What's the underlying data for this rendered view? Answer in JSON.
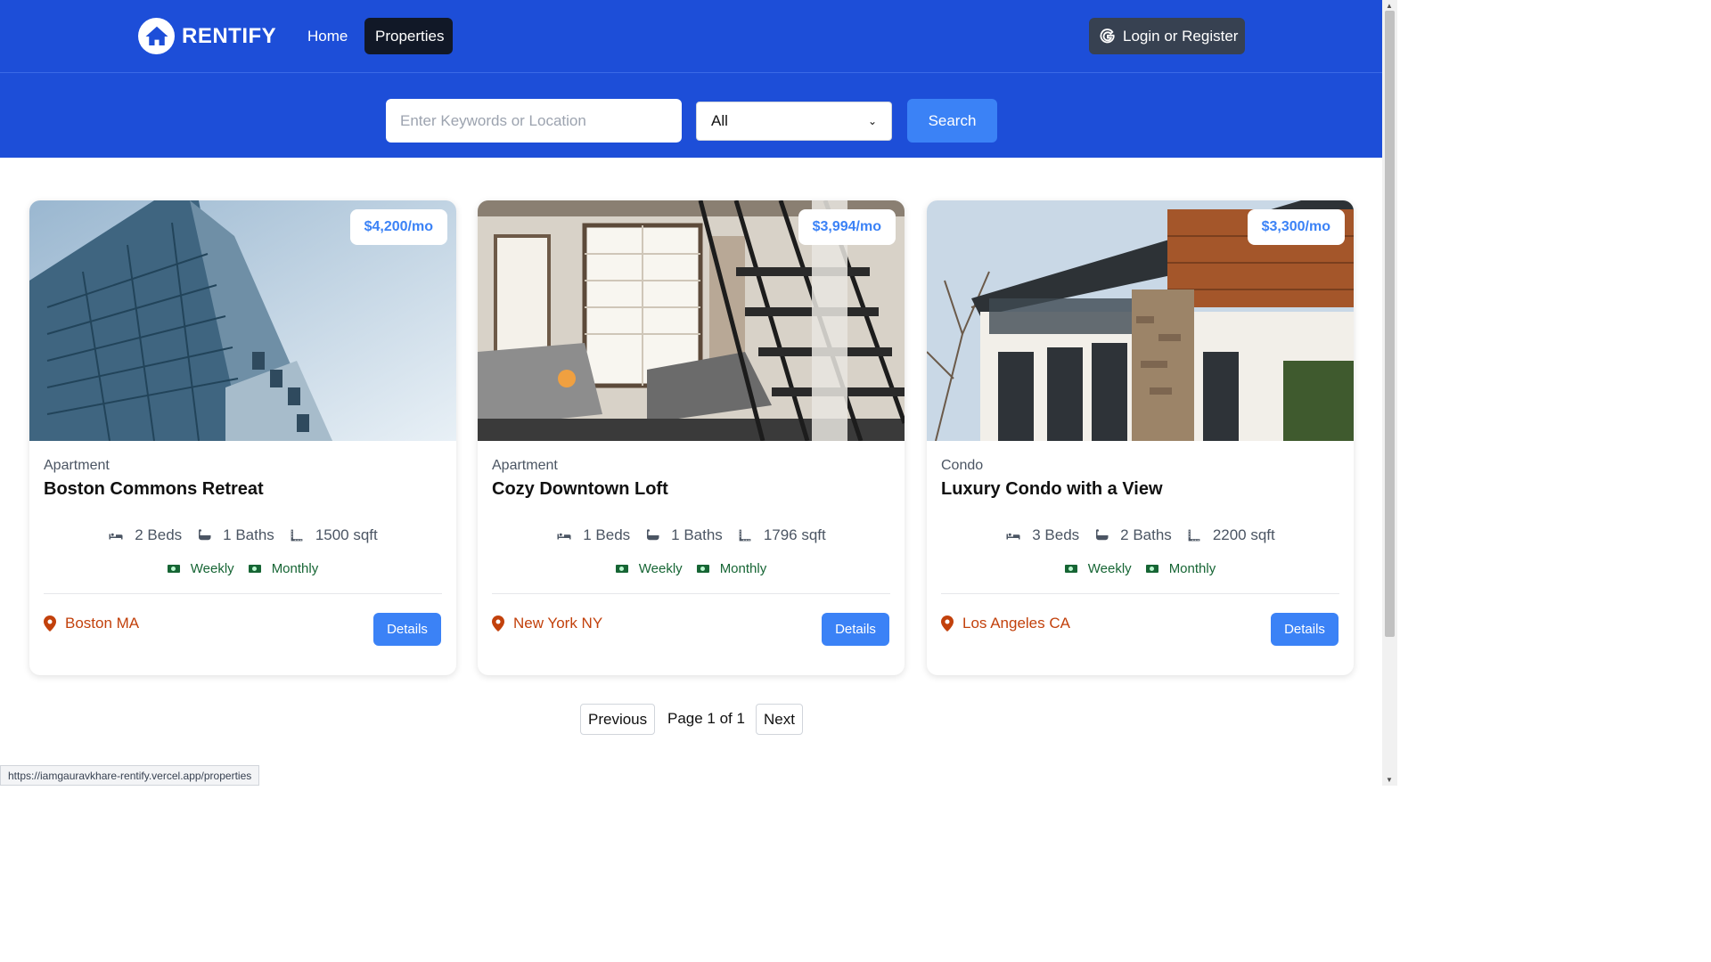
{
  "nav": {
    "brand": "RENTIFY",
    "home": "Home",
    "properties": "Properties",
    "login": "Login or Register"
  },
  "search": {
    "placeholder": "Enter Keywords or Location",
    "type_selected": "All",
    "button": "Search"
  },
  "properties": [
    {
      "type": "Apartment",
      "name": "Boston Commons Retreat",
      "price": "$4,200/mo",
      "beds": "2 Beds",
      "baths": "1 Baths",
      "sqft": "1500 sqft",
      "rate_weekly": "Weekly",
      "rate_monthly": "Monthly",
      "location": "Boston MA",
      "details": "Details"
    },
    {
      "type": "Apartment",
      "name": "Cozy Downtown Loft",
      "price": "$3,994/mo",
      "beds": "1 Beds",
      "baths": "1 Baths",
      "sqft": "1796 sqft",
      "rate_weekly": "Weekly",
      "rate_monthly": "Monthly",
      "location": "New York NY",
      "details": "Details"
    },
    {
      "type": "Condo",
      "name": "Luxury Condo with a View",
      "price": "$3,300/mo",
      "beds": "3 Beds",
      "baths": "2 Baths",
      "sqft": "2200 sqft",
      "rate_weekly": "Weekly",
      "rate_monthly": "Monthly",
      "location": "Los Angeles CA",
      "details": "Details"
    }
  ],
  "pagination": {
    "previous": "Previous",
    "page_info": "Page 1 of 1",
    "next": "Next"
  },
  "status_url": "https://iamgauravkhare-rentify.vercel.app/properties",
  "colors": {
    "primary": "#1d4ed8",
    "accent": "#3b82f6",
    "location": "#c2410c",
    "rate": "#166534"
  }
}
